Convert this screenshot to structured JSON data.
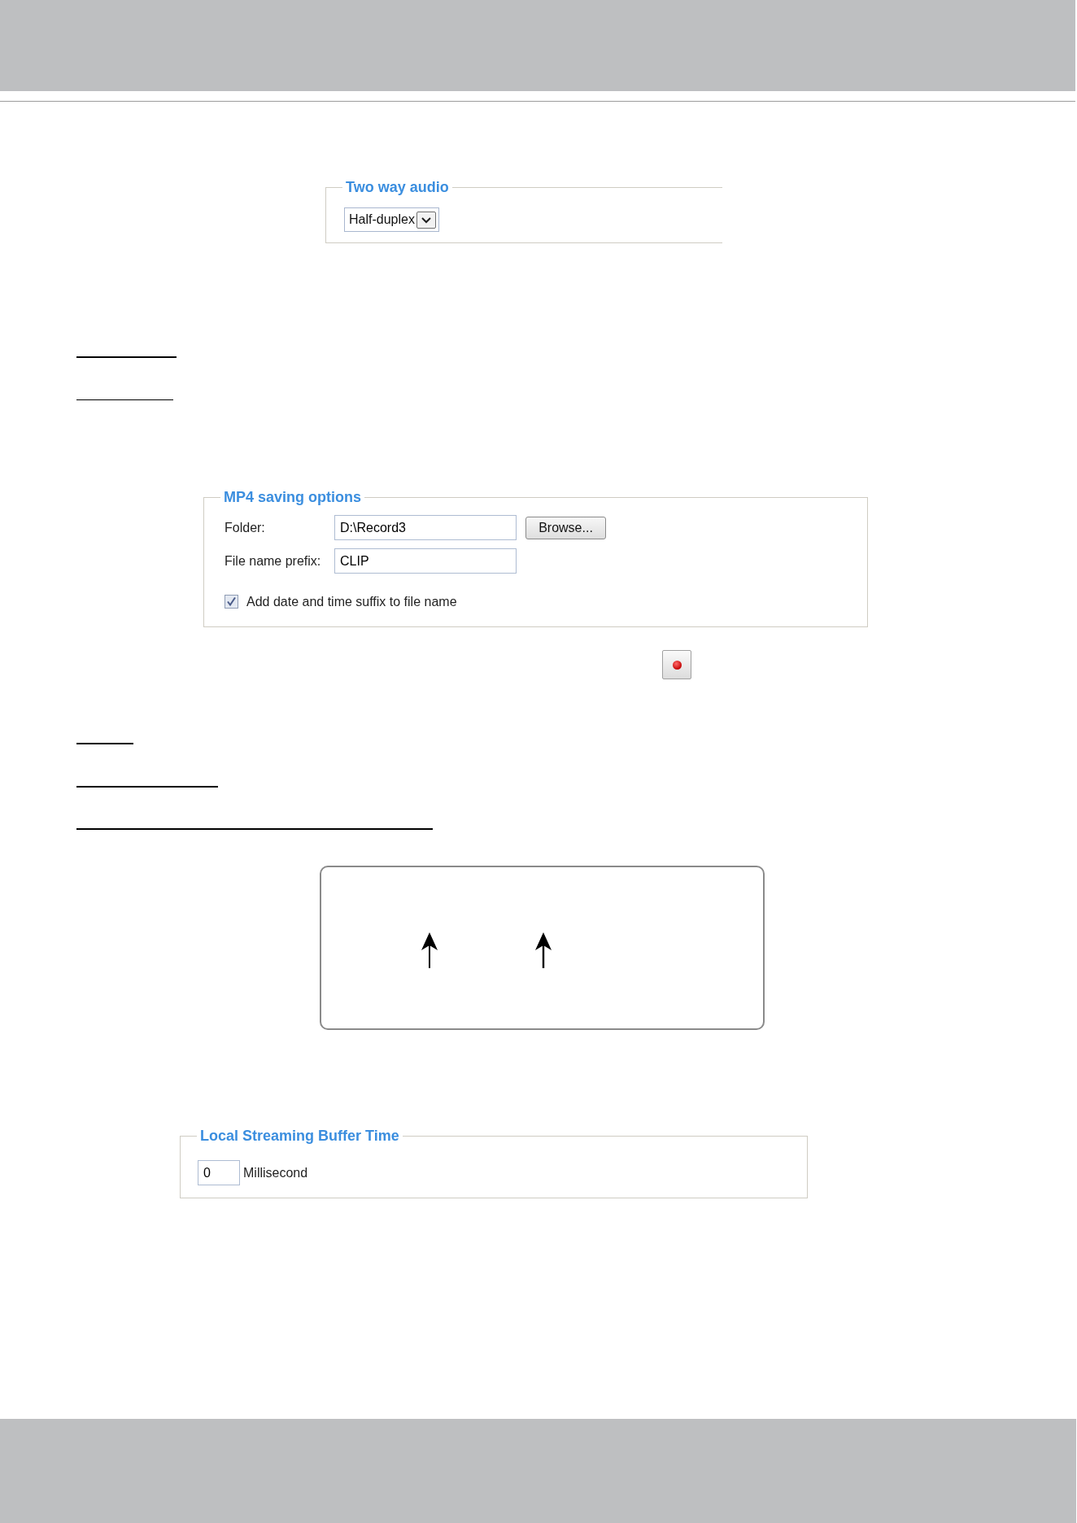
{
  "two_way_audio": {
    "legend": "Two way audio",
    "mode": "Half-duplex"
  },
  "mp4_saving_options": {
    "legend": "MP4 saving options",
    "fields": [
      {
        "label": "Folder:",
        "value": "D:\\Record3",
        "button": "Browse..."
      },
      {
        "label": "File name prefix:",
        "value": "CLIP"
      }
    ],
    "suffix_option": {
      "label": "Add date and time suffix to file name",
      "checked": true
    }
  },
  "local_streaming_buffer": {
    "legend": "Local Streaming Buffer Time",
    "value": "0",
    "unit": "Millisecond"
  }
}
